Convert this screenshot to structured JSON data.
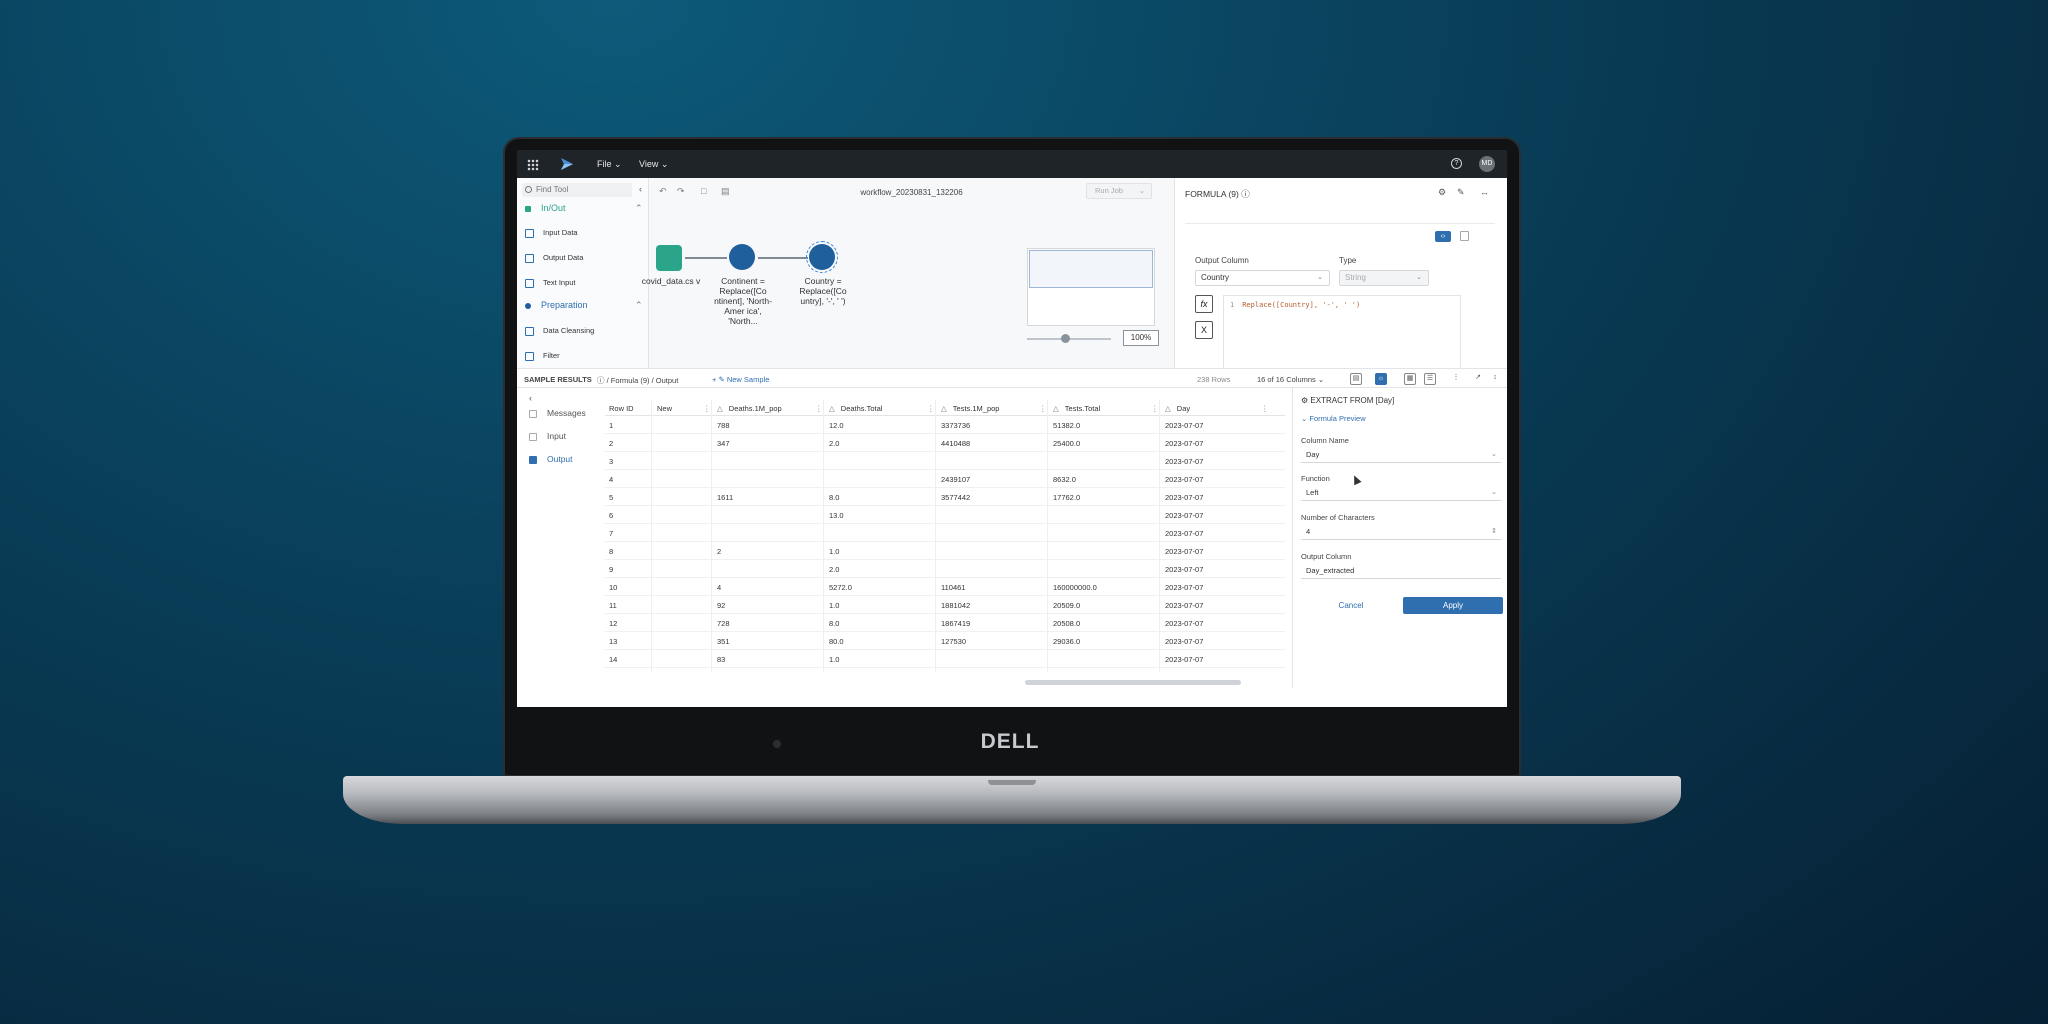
{
  "app": {
    "menu": {
      "file": "File",
      "view": "View"
    },
    "user_initials": "MD"
  },
  "tools": {
    "search_placeholder": "Find Tool",
    "sections": [
      {
        "label": "In/Out",
        "items": [
          "Input Data",
          "Output Data",
          "Text Input"
        ]
      },
      {
        "label": "Preparation",
        "items": [
          "Data Cleansing",
          "Filter"
        ]
      }
    ]
  },
  "canvas": {
    "workflow_title": "workflow_20230831_132206",
    "run_job": "Run Job",
    "zoom": "100%",
    "nodes": [
      {
        "label": "covid_data.cs v"
      },
      {
        "label": "Continent = Replace([Co ntinent], 'North-Amer ica', 'North..."
      },
      {
        "label": "Country = Replace([Co untry], '-', ' ')"
      }
    ]
  },
  "formula": {
    "title": "FORMULA (9)",
    "output_column_label": "Output Column",
    "output_column_value": "Country",
    "type_label": "Type",
    "type_value": "String",
    "fx": "fx",
    "x": "X",
    "code_line_number": "1",
    "code": "Replace([Country], '-', ' ')"
  },
  "results": {
    "title": "SAMPLE RESULTS",
    "breadcrumb": "/ Formula (9) / Output",
    "new_sample": "New Sample",
    "row_count": "238 Rows",
    "column_count": "16 of 16 Columns"
  },
  "sidenav": {
    "items": [
      {
        "label": "Messages"
      },
      {
        "label": "Input"
      },
      {
        "label": "Output"
      }
    ]
  },
  "table": {
    "headers": [
      "Row ID",
      "New",
      "Deaths.1M_pop",
      "Deaths.Total",
      "Tests.1M_pop",
      "Tests.Total",
      "Day"
    ],
    "rows": [
      [
        "1",
        "",
        "788",
        "12.0",
        "3373736",
        "51382.0",
        "2023-07-07"
      ],
      [
        "2",
        "",
        "347",
        "2.0",
        "4410488",
        "25400.0",
        "2023-07-07"
      ],
      [
        "3",
        "",
        "",
        "",
        "",
        "",
        "2023-07-07"
      ],
      [
        "4",
        "",
        "",
        "",
        "2439107",
        "8632.0",
        "2023-07-07"
      ],
      [
        "5",
        "",
        "1611",
        "8.0",
        "3577442",
        "17762.0",
        "2023-07-07"
      ],
      [
        "6",
        "",
        "",
        "13.0",
        "",
        "",
        "2023-07-07"
      ],
      [
        "7",
        "",
        "",
        "",
        "",
        "",
        "2023-07-07"
      ],
      [
        "8",
        "",
        "2",
        "1.0",
        "",
        "",
        "2023-07-07"
      ],
      [
        "9",
        "",
        "",
        "2.0",
        "",
        "",
        "2023-07-07"
      ],
      [
        "10",
        "",
        "4",
        "5272.0",
        "110461",
        "160000000.0",
        "2023-07-07"
      ],
      [
        "11",
        "",
        "92",
        "1.0",
        "1881042",
        "20509.0",
        "2023-07-07"
      ],
      [
        "12",
        "",
        "728",
        "8.0",
        "1867419",
        "20508.0",
        "2023-07-07"
      ],
      [
        "13",
        "",
        "351",
        "80.0",
        "127530",
        "29036.0",
        "2023-07-07"
      ],
      [
        "14",
        "",
        "83",
        "1.0",
        "",
        "",
        "2023-07-07"
      ]
    ]
  },
  "extract": {
    "title": "EXTRACT FROM [Day]",
    "preview": "Formula Preview",
    "column_name_label": "Column Name",
    "column_name_value": "Day",
    "function_label": "Function",
    "function_value": "Left",
    "num_chars_label": "Number of Characters",
    "num_chars_value": "4",
    "output_column_label": "Output Column",
    "output_column_value": "Day_extracted",
    "cancel": "Cancel",
    "apply": "Apply"
  },
  "laptop": {
    "brand": "DELL"
  },
  "colors": {
    "accent": "#2f6fb0",
    "node": "#1f5f9c",
    "data_node": "#2aa58a",
    "topbar": "#1f2428"
  }
}
